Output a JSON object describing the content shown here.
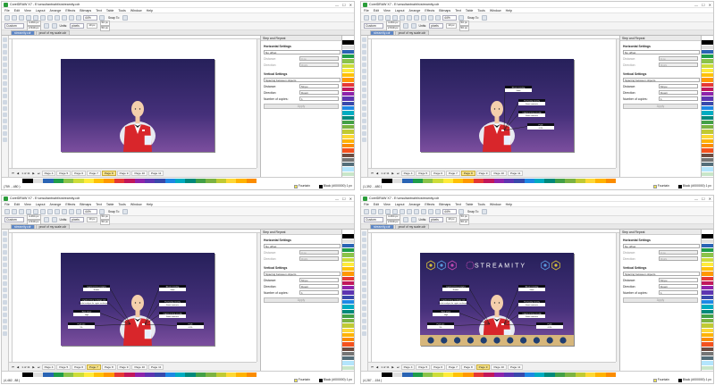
{
  "window": {
    "title": "CorelDRAW X7 - E:\\onsultantnaht\\s\\streamity.cdr",
    "minimize": "—",
    "maximize": "☐",
    "close": "✕"
  },
  "menu": [
    "File",
    "Edit",
    "View",
    "Layout",
    "Arrange",
    "Effects",
    "Bitmaps",
    "Text",
    "Table",
    "Tools",
    "Window",
    "Help"
  ],
  "toolbar": {
    "zoom": "44%",
    "snap": "Snap To",
    "preset": "Custom",
    "width": "4.494 px",
    "height": "2,549 px",
    "units_label": "Units:",
    "units": "pixels",
    "nudge": "10 px",
    "dup_x": "50 px",
    "dup_y": "50 px"
  },
  "doc_tabs": [
    "streamity.cdr",
    "proof of my scale.cdr"
  ],
  "docker": {
    "title": "Step and Repeat",
    "horizontal_title": "Horizontal Settings",
    "h_mode": "No offset",
    "distance_label": "Distance:",
    "h_distance": "0 px",
    "direction_label": "Direction:",
    "h_direction": "Right",
    "vertical_title": "Vertical Settings",
    "v_mode": "Spacing between objects",
    "v_distance": "50 px",
    "v_direction": "Down",
    "copies_label": "Number of copies:",
    "copies": "1",
    "apply": "Apply"
  },
  "page_nav": {
    "counter": "1 of 11",
    "pages": [
      "Page 4",
      "Page 5",
      "Page 6",
      "Page 7",
      "Page 8",
      "Page 9",
      "Page 10",
      "Page 11"
    ]
  },
  "status": {
    "fill": "Fountain",
    "outline": "Black (#000000)",
    "outline_size": "1 px"
  },
  "labels": {
    "nodes": [
      {
        "title": "Cryptocurrency analytics",
        "value": "Ranker"
      },
      {
        "title": "Bitcoin investing",
        "value": "Show"
      },
      {
        "title": "Cryptocurrency exchange rate",
        "value": "Market analysis for crypto exchanges"
      },
      {
        "title": "Purchasing security",
        "value": "Smart contracts"
      },
      {
        "title": "Ease of use",
        "value": "High"
      },
      {
        "title": "Cryptocurrency security",
        "value": "Smart contracts"
      },
      {
        "title": "Profit rate",
        "value": "5%"
      },
      {
        "title": "Profit",
        "value": "0.3%"
      }
    ]
  },
  "brand": "STREAMITY",
  "windows": [
    {
      "step": 1,
      "current_page": "Page 8",
      "status": "(759 , -480 )"
    },
    {
      "step": 2,
      "current_page": "Page 8",
      "status": "(1,392 , -480 )"
    },
    {
      "step": 3,
      "current_page": "Page 7",
      "status": "(4,482 , 88 )"
    },
    {
      "step": 4,
      "current_page": "Page 9",
      "status": "(4,287 , -154 )"
    }
  ],
  "palette": [
    "#ffffff",
    "#000000",
    "#e0e0e0",
    "#2a64b4",
    "#1f9d4a",
    "#8bc34a",
    "#cddc39",
    "#ffeb3b",
    "#ffc107",
    "#ff9800",
    "#e53935",
    "#c2185b",
    "#8e24aa",
    "#5e35b1",
    "#3949ab",
    "#1e88e5",
    "#00acc1",
    "#00897b",
    "#43a047",
    "#7cb342",
    "#c0ca33",
    "#fdd835",
    "#ffb300",
    "#fb8c00",
    "#f4511e",
    "#6d4c41",
    "#757575",
    "#546e7a",
    "#b3e5fc",
    "#c8e6c9"
  ]
}
